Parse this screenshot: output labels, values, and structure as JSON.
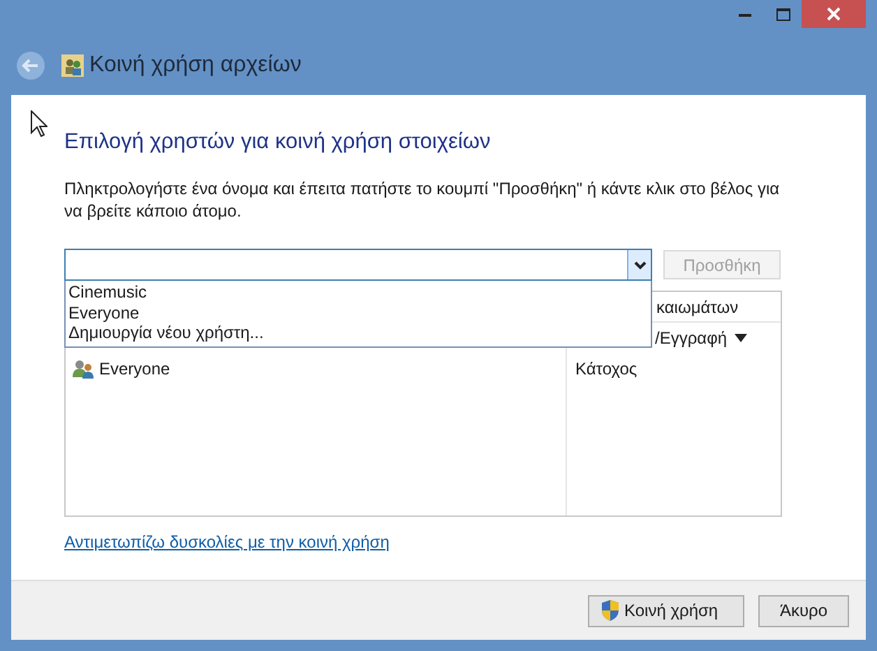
{
  "window": {
    "title": "Κοινή χρήση αρχείων"
  },
  "heading": "Επιλογή χρηστών για κοινή χρήση στοιχείων",
  "instructions": "Πληκτρολογήστε ένα όνομα και έπειτα πατήστε το κουμπί \"Προσθήκη\" ή κάντε κλικ στο βέλος για να βρείτε κάποιο άτομο.",
  "name_field": {
    "expanded": true,
    "options": [
      "Cinemusic",
      "Everyone",
      "Δημιουργία νέου χρήστη..."
    ]
  },
  "add_button": {
    "label": "Προσθήκη",
    "disabled": true
  },
  "table": {
    "column_2_header": "καιωμάτων",
    "rows": [
      {
        "permission": "/Εγγραφή",
        "has_menu": true
      },
      {
        "name": "Everyone",
        "permission": "Κάτοχος",
        "has_menu": false
      }
    ]
  },
  "help_link": "Αντιμετωπίζω δυσκολίες με την κοινή χρήση",
  "buttons": [
    {
      "label": "Κοινή χρήση",
      "kind": "shield"
    },
    {
      "label": "Άκυρο",
      "kind": "plain"
    }
  ]
}
